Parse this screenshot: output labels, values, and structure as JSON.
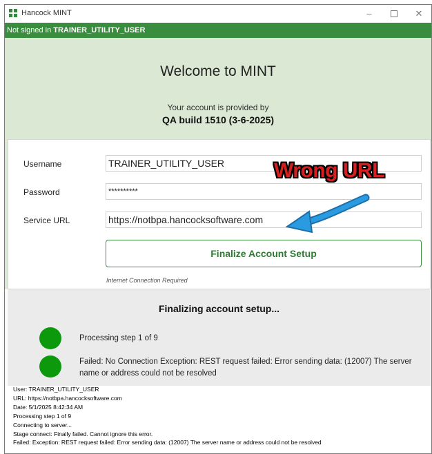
{
  "window": {
    "title": "Hancock MINT",
    "controls": {
      "minimize": "–",
      "close": "✕"
    }
  },
  "status": {
    "prefix": "Not signed in",
    "user": "TRAINER_UTILITY_USER"
  },
  "header": {
    "welcome": "Welcome to MINT",
    "provided_by": "Your account is provided by",
    "build": "QA build 1510 (3-6-2025)"
  },
  "form": {
    "username_label": "Username",
    "username_value": "TRAINER_UTILITY_USER",
    "password_label": "Password",
    "password_value": "**********",
    "service_url_label": "Service URL",
    "service_url_value": "https://notbpa.hancocksoftware.com",
    "finalize_label": "Finalize Account Setup",
    "note": "Internet Connection Required"
  },
  "progress": {
    "heading": "Finalizing account setup...",
    "steps": [
      {
        "text": "Processing step 1 of 9",
        "color": "#0c9a0c"
      },
      {
        "text": "Failed: No Connection Exception: REST request failed: Error sending data: (12007) The server name or address could not be resolved",
        "color": "#0c9a0c"
      }
    ]
  },
  "log": [
    "User: TRAINER_UTILITY_USER",
    "URL: https://notbpa.hancocksoftware.com",
    "Date: 5/1/2025 8:42:34 AM",
    "Processing step 1 of 9",
    "Connecting to server...",
    "Stage connect: Finally failed. Cannot ignore this error.",
    "Failed: Exception: REST request failed: Error sending data: (12007) The server name or address could not be resolved"
  ],
  "annotation": {
    "text": "Wrong URL",
    "text_color": "#d62020",
    "arrow_color": "#2a9be0"
  },
  "colors": {
    "brand_green": "#3a8c3f",
    "hero_bg": "#dbe9d4"
  }
}
